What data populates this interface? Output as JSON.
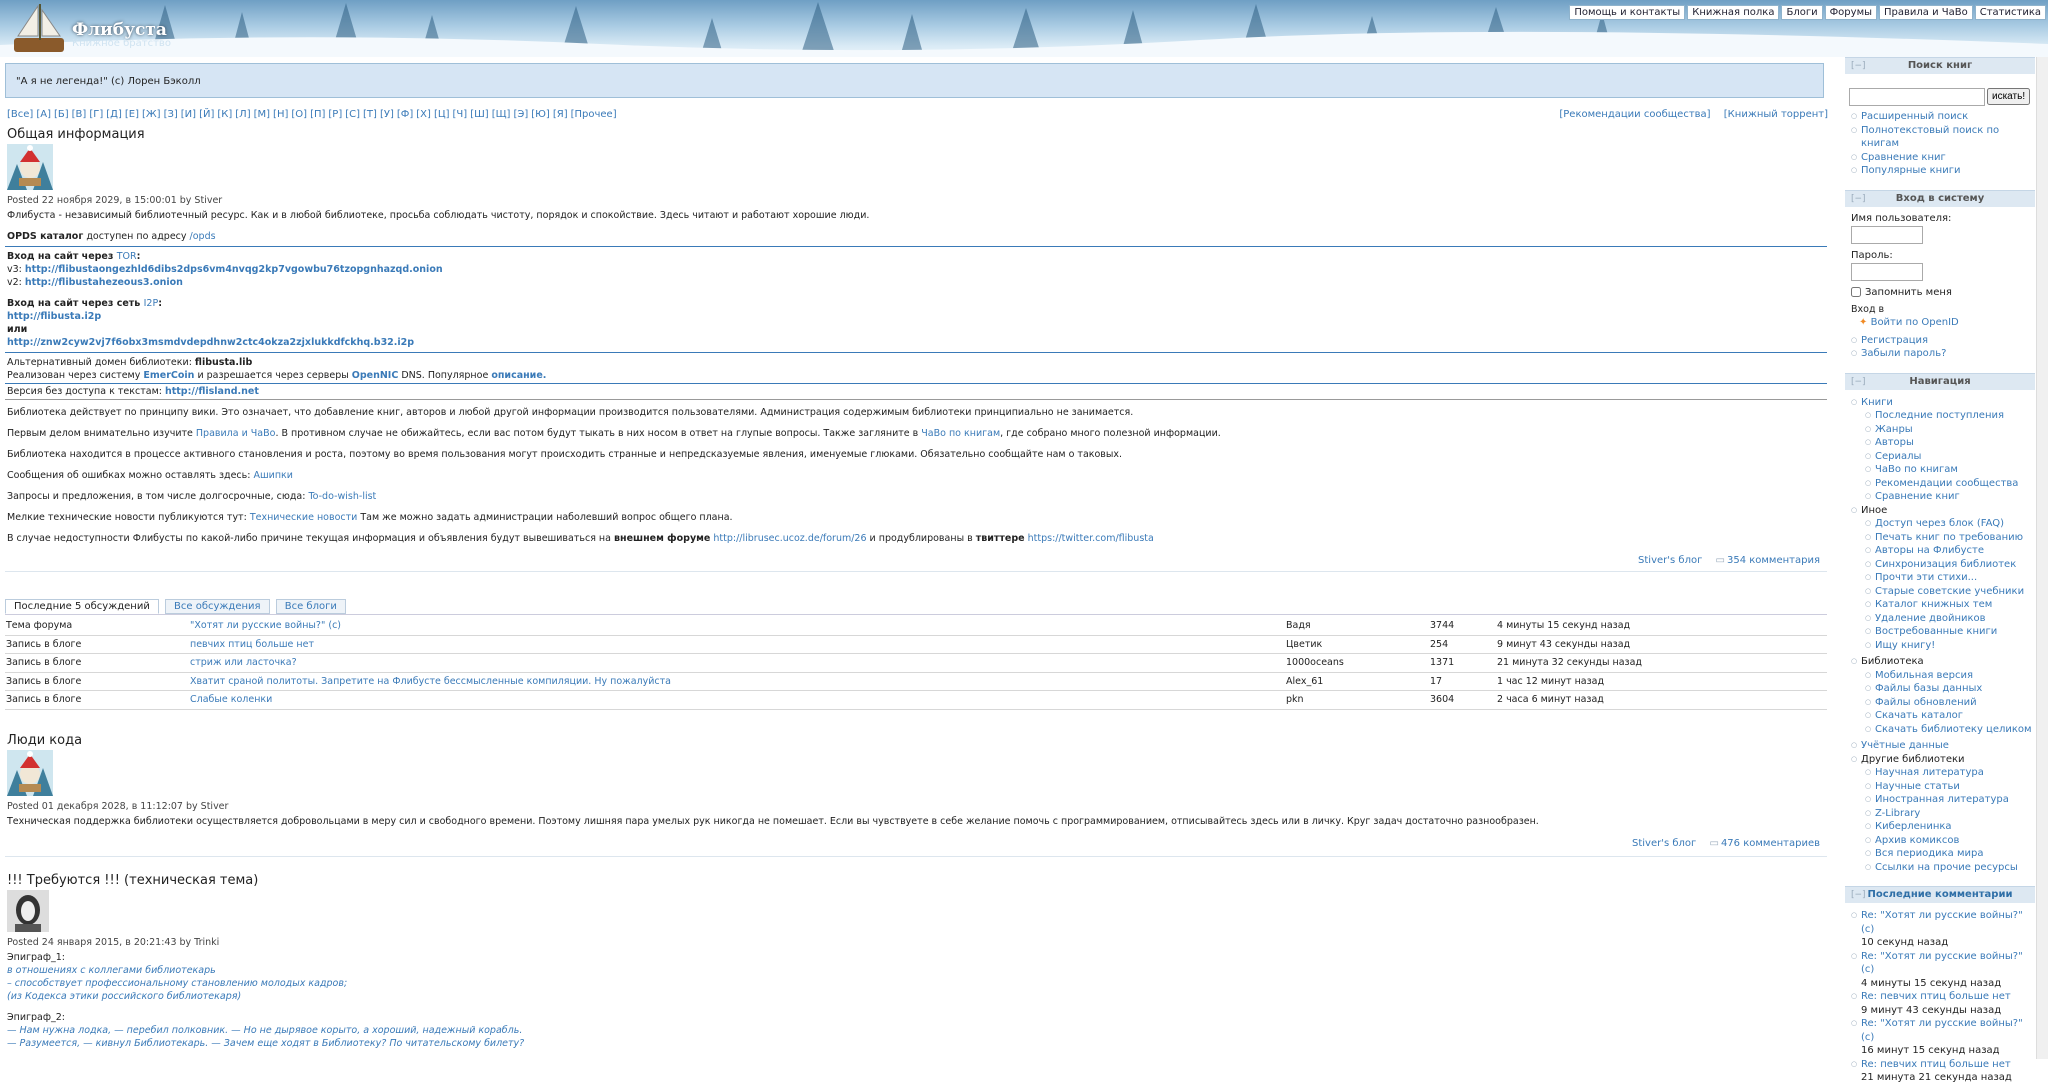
{
  "header": {
    "site_name": "Флибуста",
    "slogan": "Книжное братство",
    "nav": [
      "Помощь и контакты",
      "Книжная полка",
      "Блоги",
      "Форумы",
      "Правила и ЧаВо",
      "Статистика"
    ]
  },
  "quote": "\"А я не легенда!\" (с) Лорен Бэколл",
  "alphabet": [
    "[Все]",
    "[А]",
    "[Б]",
    "[В]",
    "[Г]",
    "[Д]",
    "[Е]",
    "[Ж]",
    "[З]",
    "[И]",
    "[Й]",
    "[К]",
    "[Л]",
    "[М]",
    "[Н]",
    "[О]",
    "[П]",
    "[Р]",
    "[С]",
    "[Т]",
    "[У]",
    "[Ф]",
    "[Х]",
    "[Ц]",
    "[Ч]",
    "[Ш]",
    "[Щ]",
    "[Э]",
    "[Ю]",
    "[Я]",
    "[Прочее]"
  ],
  "rec_links": [
    "[Рекомендации сообщества]",
    "[Книжный торрент]"
  ],
  "node1": {
    "title": "Общая информация",
    "submitted": "Posted 22 ноября 2029, в 15:00:01 by Stiver",
    "intro": "Флибуста - независимый библиотечный ресурс. Как и в любой библиотеке, просьба соблюдать чистоту, порядок и спокойствие. Здесь читают и работают хорошие люди.",
    "opds_label": "OPDS каталог",
    "opds_text": " доступен по адресу ",
    "opds_link": "/opds",
    "tor_label": "Вход на сайт через ",
    "tor_link": "TOR",
    "v3_label": "v3: ",
    "v3_link": "http://flibustaongezhld6dibs2dps6vm4nvqg2kp7vgowbu76tzopgnhazqd.onion",
    "v2_label": "v2: ",
    "v2_link": "http://flibustahezeous3.onion",
    "i2p_label": "Вход на сайт через сеть ",
    "i2p_link": "I2P",
    "i2p_url1": "http://flibusta.i2p",
    "or": "или",
    "i2p_url2": "http://znw2cyw2vj7f6obx3msmdvdepdhnw2ctc4okza2zjxlukkdfckhq.b32.i2p",
    "alt_domain_label": "Альтернативный домен библиотеки: ",
    "alt_domain": "flibusta.lib",
    "emer_text1": "Реализован через систему ",
    "emer_link": "EmerCoin",
    "emer_text2": " и разрешается через серверы ",
    "opennic_link": "OpenNIC",
    "emer_text3": " DNS. Популярное ",
    "descr_link": "описание.",
    "notext_label": "Версия без доступа к текстам: ",
    "notext_link": "http://flisland.net",
    "p_wiki": "Библиотека действует по принципу вики. Это означает, что добавление книг, авторов и любой другой информации производится пользователями. Администрация содержимым библиотеки принципиально не занимается.",
    "p_rules1": "Первым делом внимательно изучите ",
    "p_rules_link": "Правила и ЧаВо",
    "p_rules2": ". В противном случае не обижайтесь, если вас потом будут тыкать в них носом в ответ на глупые вопросы. Также загляните в ",
    "p_rules_link2": "ЧаВо по книгам",
    "p_rules3": ", где собрано много полезной информации.",
    "p_growth": "Библиотека находится в процессе активного становления и роста, поэтому во время пользования могут происходить странные и непредсказуемые явления, именуемые глюками. Обязательно сообщайте нам о таковых.",
    "p_errors": "Сообщения об ошибках можно оставлять здесь: ",
    "p_errors_link": "Ашипки",
    "p_wishes": "Запросы и предложения, в том числе долгосрочные, сюда: ",
    "p_wishes_link": "To-do-wish-list",
    "p_news": "Мелкие технические новости публикуются тут: ",
    "p_news_link": "Технические новости",
    "p_news2": " Там же можно задать администрации наболевший вопрос общего плана.",
    "p_outage1": "В случае недоступности Флибусты по какой-либо причине текущая информация и объявления будут вывешиваться на ",
    "p_outage_b1": "внешнем форуме",
    "p_outage_link1": "http://librusec.ucoz.de/forum/26",
    "p_outage2": " и продублированы в ",
    "p_outage_b2": "твиттере",
    "p_outage_link2": "https://twitter.com/flibusta",
    "blog_link": "Stiver's блог",
    "comments_link": "354 комментария"
  },
  "tabs": [
    "Последние 5 обсуждений",
    "Все обсуждения",
    "Все блоги"
  ],
  "discussions": [
    {
      "type": "Тема форума",
      "title": "\"Хотят ли русские войны?\" (с)",
      "author": "Вадя",
      "count": "3744",
      "time": "4 минуты 15 секунд назад"
    },
    {
      "type": "Запись в блоге",
      "title": "певчих птиц больше нет",
      "author": "Цветик",
      "count": "254",
      "time": "9 минут 43 секунды назад"
    },
    {
      "type": "Запись в блоге",
      "title": "стриж или ласточка?",
      "author": "1000oceans",
      "count": "1371",
      "time": "21 минута 32 секунды назад"
    },
    {
      "type": "Запись в блоге",
      "title": "Хватит сраной политоты. Запретите на Флибусте бессмысленные компиляции. Ну пожалуйста",
      "author": "Alex_61",
      "count": "17",
      "time": "1 час 12 минут назад"
    },
    {
      "type": "Запись в блоге",
      "title": "Слабые коленки",
      "author": "pkn",
      "count": "3604",
      "time": "2 часа 6 минут назад"
    }
  ],
  "node2": {
    "title": "Люди кода",
    "submitted": "Posted 01 декабря 2028, в 11:12:07 by Stiver",
    "body": "Техническая поддержка библиотеки осуществляется добровольцами в меру сил и свободного времени. Поэтому лишняя пара умелых рук никогда не помешает. Если вы чувствуете в себе желание помочь с программированием, отписывайтесь здесь или в личку. Круг задач достаточно разнообразен.",
    "blog_link": "Stiver's блог",
    "comments_link": "476 комментариев"
  },
  "node3": {
    "title": "!!! Требуются !!! (техническая тема)",
    "submitted": "Posted 24 января 2015, в 20:21:43 by Trinki",
    "ep1": "Эпиграф_1:",
    "ep1_lines": [
      "в отношениях с коллегами библиотекарь",
      "– способствует профессиональному становлению молодых кадров;",
      "(из Кодекса этики российского библиотекаря)"
    ],
    "ep2": "Эпиграф_2:",
    "ep2_lines": [
      "— Нам нужна лодка, — перебил полковник. — Но не дырявое корыто, а хороший, надежный корабль.",
      "— Разумеется, — кивнул Библиотекарь. — Зачем еще ходят в Библиотеку? По читательскому билету?"
    ]
  },
  "sidebar": {
    "search_title": "Поиск книг",
    "search_button": "искать!",
    "search_links": [
      "Расширенный поиск",
      "Полнотекстовый поиск по книгам",
      "Сравнение книг",
      "Популярные книги"
    ],
    "login_title": "Вход в систему",
    "username_label": "Имя пользователя:",
    "password_label": "Пароль:",
    "remember_label": "Запомнить меня",
    "login_via": "Вход в",
    "openid": "Войти по OpenID",
    "login_links": [
      "Регистрация",
      "Забыли пароль?"
    ],
    "nav_title": "Навигация",
    "nav_books": "Книги",
    "nav_books_items": [
      "Последние поступления",
      "Жанры",
      "Авторы",
      "Сериалы",
      "ЧаВо по книгам",
      "Рекомендации сообщества",
      "Сравнение книг"
    ],
    "nav_other": "Иное",
    "nav_other_items": [
      "Доступ через блок (FAQ)",
      "Печать книг по требованию",
      "Авторы на Флибусте",
      "Синхронизация библиотек",
      "Прочти эти стихи...",
      "Старые советские учебники",
      "Каталог книжных тем",
      "Удаление двойников",
      "Востребованные книги",
      "Ищу книгу!"
    ],
    "nav_library": "Библиотека",
    "nav_library_items": [
      "Мобильная версия",
      "Файлы базы данных",
      "Файлы обновлений",
      "Скачать каталог",
      "Скачать библиотеку целиком"
    ],
    "nav_account": "Учётные данные",
    "nav_otherlibs": "Другие библиотеки",
    "nav_otherlibs_items": [
      "Научная литература",
      "Научные статьи",
      "Иностранная литература",
      "Z-Library",
      "Киберленинка",
      "Архив комиксов",
      "Вся периодика мира",
      "Ссылки на прочие ресурсы"
    ],
    "comments_title": "Последние комментарии",
    "comments": [
      {
        "title": "Re: \"Хотят ли русские войны?\" (с)",
        "time": "10 секунд назад"
      },
      {
        "title": "Re: \"Хотят ли русские войны?\" (с)",
        "time": "4 минуты 15 секунд назад"
      },
      {
        "title": "Re: певчих птиц больше нет",
        "time": "9 минут 43 секунды назад"
      },
      {
        "title": "Re: \"Хотят ли русские войны?\" (с)",
        "time": "16 минут 15 секунд назад"
      },
      {
        "title": "Re: певчих птиц больше нет",
        "time": "21 минута 21 секунда назад"
      }
    ]
  },
  "colors": {
    "link": "#3a7ab8",
    "header_sky": "#a9cbe3",
    "quote_bg": "#d6e5f4",
    "sidebar_head": "#dde8f2"
  }
}
